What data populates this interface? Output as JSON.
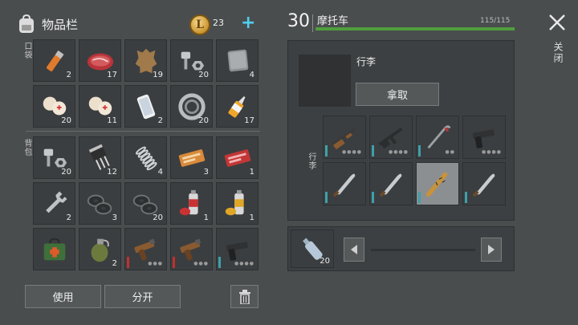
{
  "inventory": {
    "title": "物品栏",
    "coins": "23",
    "coin_symbol": "L",
    "plus": "+",
    "pocket_label": "口袋",
    "backpack_label": "背包",
    "pocket_items": [
      {
        "icon": "lighter-icon",
        "count": "2"
      },
      {
        "icon": "raw-meat-icon",
        "count": "17"
      },
      {
        "icon": "leather-icon",
        "count": "19"
      },
      {
        "icon": "bolts-nuts-icon",
        "count": "20"
      },
      {
        "icon": "metal-plate-icon",
        "count": "4"
      },
      {
        "icon": "bandage-icon",
        "count": "20"
      },
      {
        "icon": "bandage-icon",
        "count": "11"
      },
      {
        "icon": "smartphone-icon",
        "count": "2"
      },
      {
        "icon": "bearing-icon",
        "count": "20"
      },
      {
        "icon": "glue-icon",
        "count": "17"
      }
    ],
    "backpack_items": [
      {
        "icon": "bolts-nuts-icon",
        "count": "20"
      },
      {
        "icon": "transistor-icon",
        "count": "12"
      },
      {
        "icon": "spring-icon",
        "count": "4"
      },
      {
        "icon": "coupon-orange-icon",
        "count": "3"
      },
      {
        "icon": "coupon-red-icon",
        "count": "1"
      },
      {
        "icon": "wrench-icon",
        "count": "2"
      },
      {
        "icon": "washers-icon",
        "count": "3"
      },
      {
        "icon": "washers-icon",
        "count": "20"
      },
      {
        "icon": "spray-red-icon",
        "count": "1"
      },
      {
        "icon": "spray-yellow-icon",
        "count": "1"
      },
      {
        "icon": "medkit-bag-icon",
        "count": ""
      },
      {
        "icon": "grenade-icon",
        "count": "2"
      },
      {
        "icon": "flare-pistol-icon",
        "count": ""
      },
      {
        "icon": "flare-pistol-icon",
        "count": ""
      },
      {
        "icon": "pistol-icon",
        "count": ""
      }
    ],
    "use_label": "使用",
    "split_label": "分开"
  },
  "vehicle": {
    "level": "30",
    "name": "摩托车",
    "capacity": "115/115",
    "fill": 1.0,
    "luggage_title": "行李",
    "take_label": "拿取",
    "luggage_side_label": "行李",
    "items": [
      {
        "icon": "shotgun-icon"
      },
      {
        "icon": "rifle-icon"
      },
      {
        "icon": "crowbar-icon"
      },
      {
        "icon": "pistol-icon"
      },
      {
        "icon": "machete-icon"
      },
      {
        "icon": "machete-icon"
      },
      {
        "icon": "spiked-bat-icon"
      },
      {
        "icon": "machete-icon"
      }
    ],
    "fuel_count": "20"
  },
  "close_label": "关闭",
  "colors": {
    "bar": "#4f9f3c",
    "accent": "#4fd0ee"
  }
}
